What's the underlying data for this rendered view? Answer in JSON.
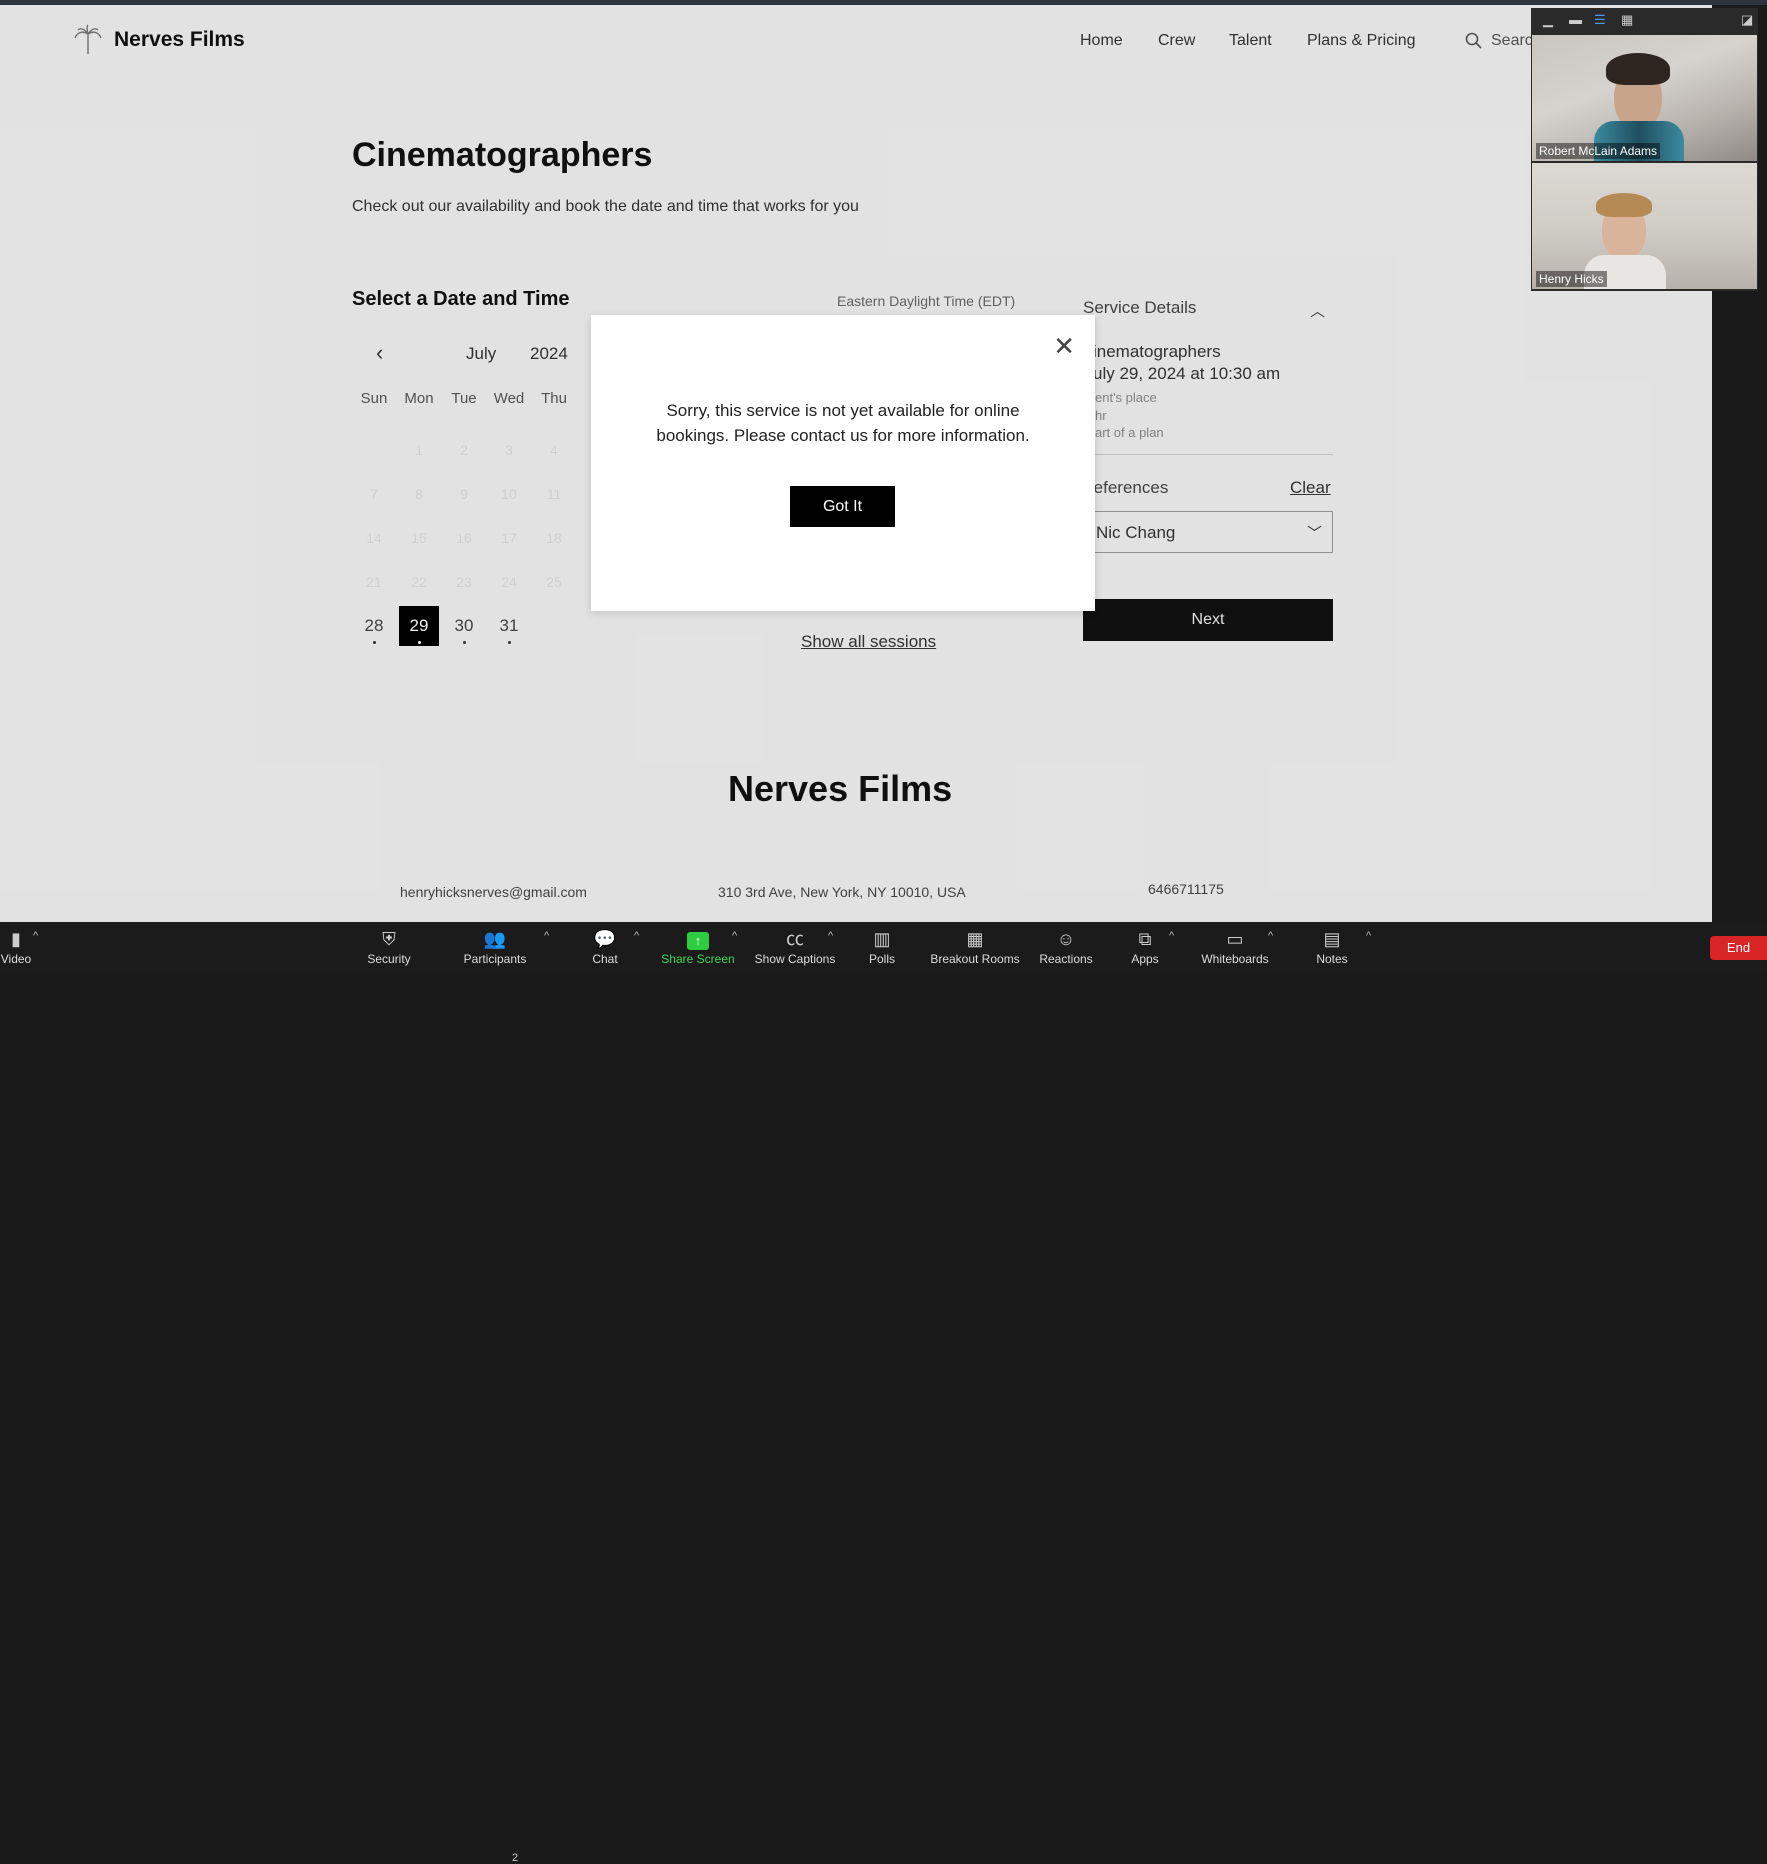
{
  "site": {
    "logo_text": "Nerves Films",
    "nav": [
      "Home",
      "Crew",
      "Talent",
      "Plans & Pricing"
    ],
    "search_label": "Searc"
  },
  "page": {
    "title": "Cinematographers",
    "subtitle": "Check out our availability and book the date and time that works for you",
    "select_title": "Select a Date and Time",
    "timezone": "Eastern Daylight Time (EDT)",
    "month": "July",
    "year": "2024",
    "days_of_week": [
      "Sun",
      "Mon",
      "Tue",
      "Wed",
      "Thu"
    ],
    "faded_days": [
      "1",
      "2",
      "3",
      "4",
      "7",
      "8",
      "9",
      "10",
      "11",
      "14",
      "15",
      "16",
      "17",
      "18",
      "21",
      "22",
      "23",
      "24",
      "25"
    ],
    "last_week": [
      "28",
      "29",
      "30",
      "31"
    ],
    "selected_day": "29",
    "show_all_sessions": "Show all sessions"
  },
  "service": {
    "heading": "Service Details",
    "name": "inematographers",
    "datetime": "uly 29, 2024 at 10:30 am",
    "location": "ent's place",
    "duration": "hr",
    "plan": "art of a plan",
    "preferences_label": "references",
    "clear_label": "Clear",
    "staff_selected": "Nic Chang",
    "next_label": "Next"
  },
  "footer": {
    "title": "Nerves Films",
    "email": "henryhicksnerves@gmail.com",
    "address": "310 3rd Ave, New York, NY 10010, USA",
    "phone": "6466711175"
  },
  "modal": {
    "message_line1": "Sorry, this service is not yet available for online",
    "message_line2": "bookings. Please contact us for more information.",
    "button": "Got It"
  },
  "video_panel": {
    "participants": [
      {
        "name": "Robert McLain Adams"
      },
      {
        "name": "Henry Hicks"
      }
    ]
  },
  "zoom_toolbar": {
    "video_label": "Video",
    "items": [
      "Security",
      "Participants",
      "Chat",
      "Share Screen",
      "Show Captions",
      "Polls",
      "Breakout Rooms",
      "Reactions",
      "Apps",
      "Whiteboards",
      "Notes"
    ],
    "participants_count": "2",
    "end_label": "End",
    "share_color": "#3fd45a",
    "end_color": "#d92525"
  }
}
